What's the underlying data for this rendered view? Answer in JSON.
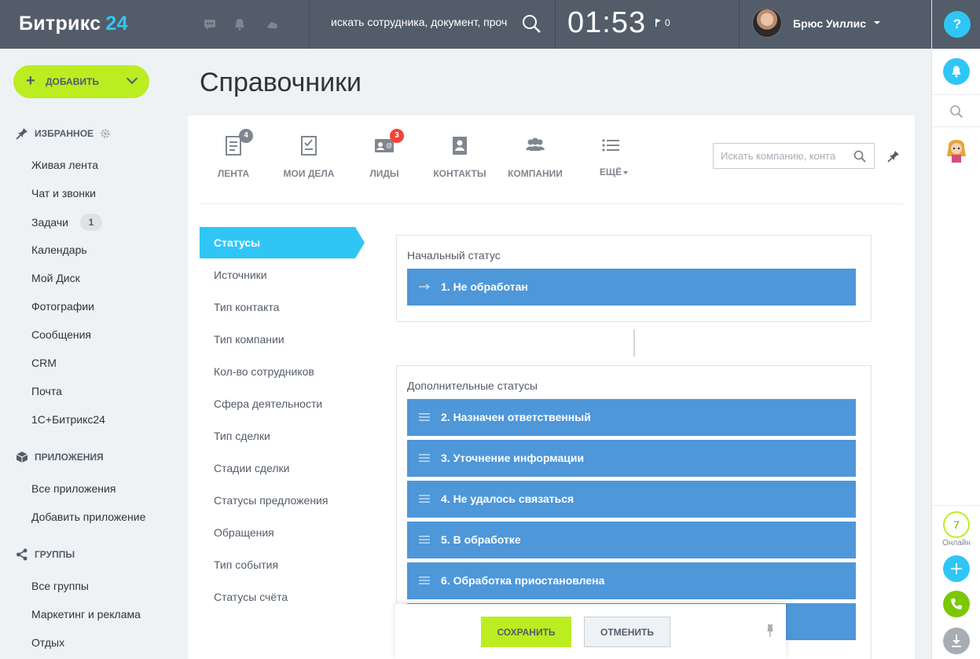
{
  "header": {
    "logo": "Битрикс",
    "logo_num": "24",
    "search_placeholder": "искать сотрудника, документ, проч",
    "clock": "01:53",
    "flag_count": "0",
    "user_name": "Брюс Уиллис",
    "help": "?"
  },
  "sidebar": {
    "add_label": "ДОБАВИТЬ",
    "sections": {
      "favorites": "ИЗБРАННОЕ",
      "apps": "ПРИЛОЖЕНИЯ",
      "groups": "ГРУППЫ"
    },
    "favorites": [
      "Живая лента",
      "Чат и звонки",
      "Задачи",
      "Календарь",
      "Мой Диск",
      "Фотографии",
      "Сообщения",
      "CRM",
      "Почта",
      "1С+Битрикс24"
    ],
    "tasks_badge": "1",
    "apps": [
      "Все приложения",
      "Добавить приложение"
    ],
    "groups": [
      "Все группы",
      "Маркетинг и реклама",
      "Отдых"
    ]
  },
  "main": {
    "title": "Справочники",
    "tabs": [
      {
        "label": "ЛЕНТА",
        "count": "4"
      },
      {
        "label": "МОИ ДЕЛА",
        "count": ""
      },
      {
        "label": "ЛИДЫ",
        "count": "3"
      },
      {
        "label": "КОНТАКТЫ",
        "count": ""
      },
      {
        "label": "КОМПАНИИ",
        "count": ""
      },
      {
        "label": "ЕЩЁ",
        "count": ""
      }
    ],
    "crm_search_placeholder": "Искать компанию, конта",
    "menu": [
      "Статусы",
      "Источники",
      "Тип контакта",
      "Тип компании",
      "Кол-во сотрудников",
      "Сфера деятельности",
      "Тип сделки",
      "Стадии сделки",
      "Статусы предложения",
      "Обращения",
      "Тип события",
      "Статусы счёта"
    ],
    "initial_title": "Начальный статус",
    "initial_status": "1. Не обработан",
    "additional_title": "Дополнительные статусы",
    "additional_statuses": [
      "2. Назначен ответственный",
      "3. Уточнение информации",
      "4. Не удалось связаться",
      "5. В обработке",
      "6. Обработка приостановлена"
    ],
    "save": "СОХРАНИТЬ",
    "cancel": "ОТМЕНИТЬ"
  },
  "rightbar": {
    "online_count": "7",
    "online_label": "Онлайн"
  },
  "colors": {
    "header_bg": "#535c69",
    "accent_blue": "#2fc6f6",
    "status_blue": "#4e97d9",
    "green": "#bbed21",
    "badge_red": "#f44336"
  }
}
